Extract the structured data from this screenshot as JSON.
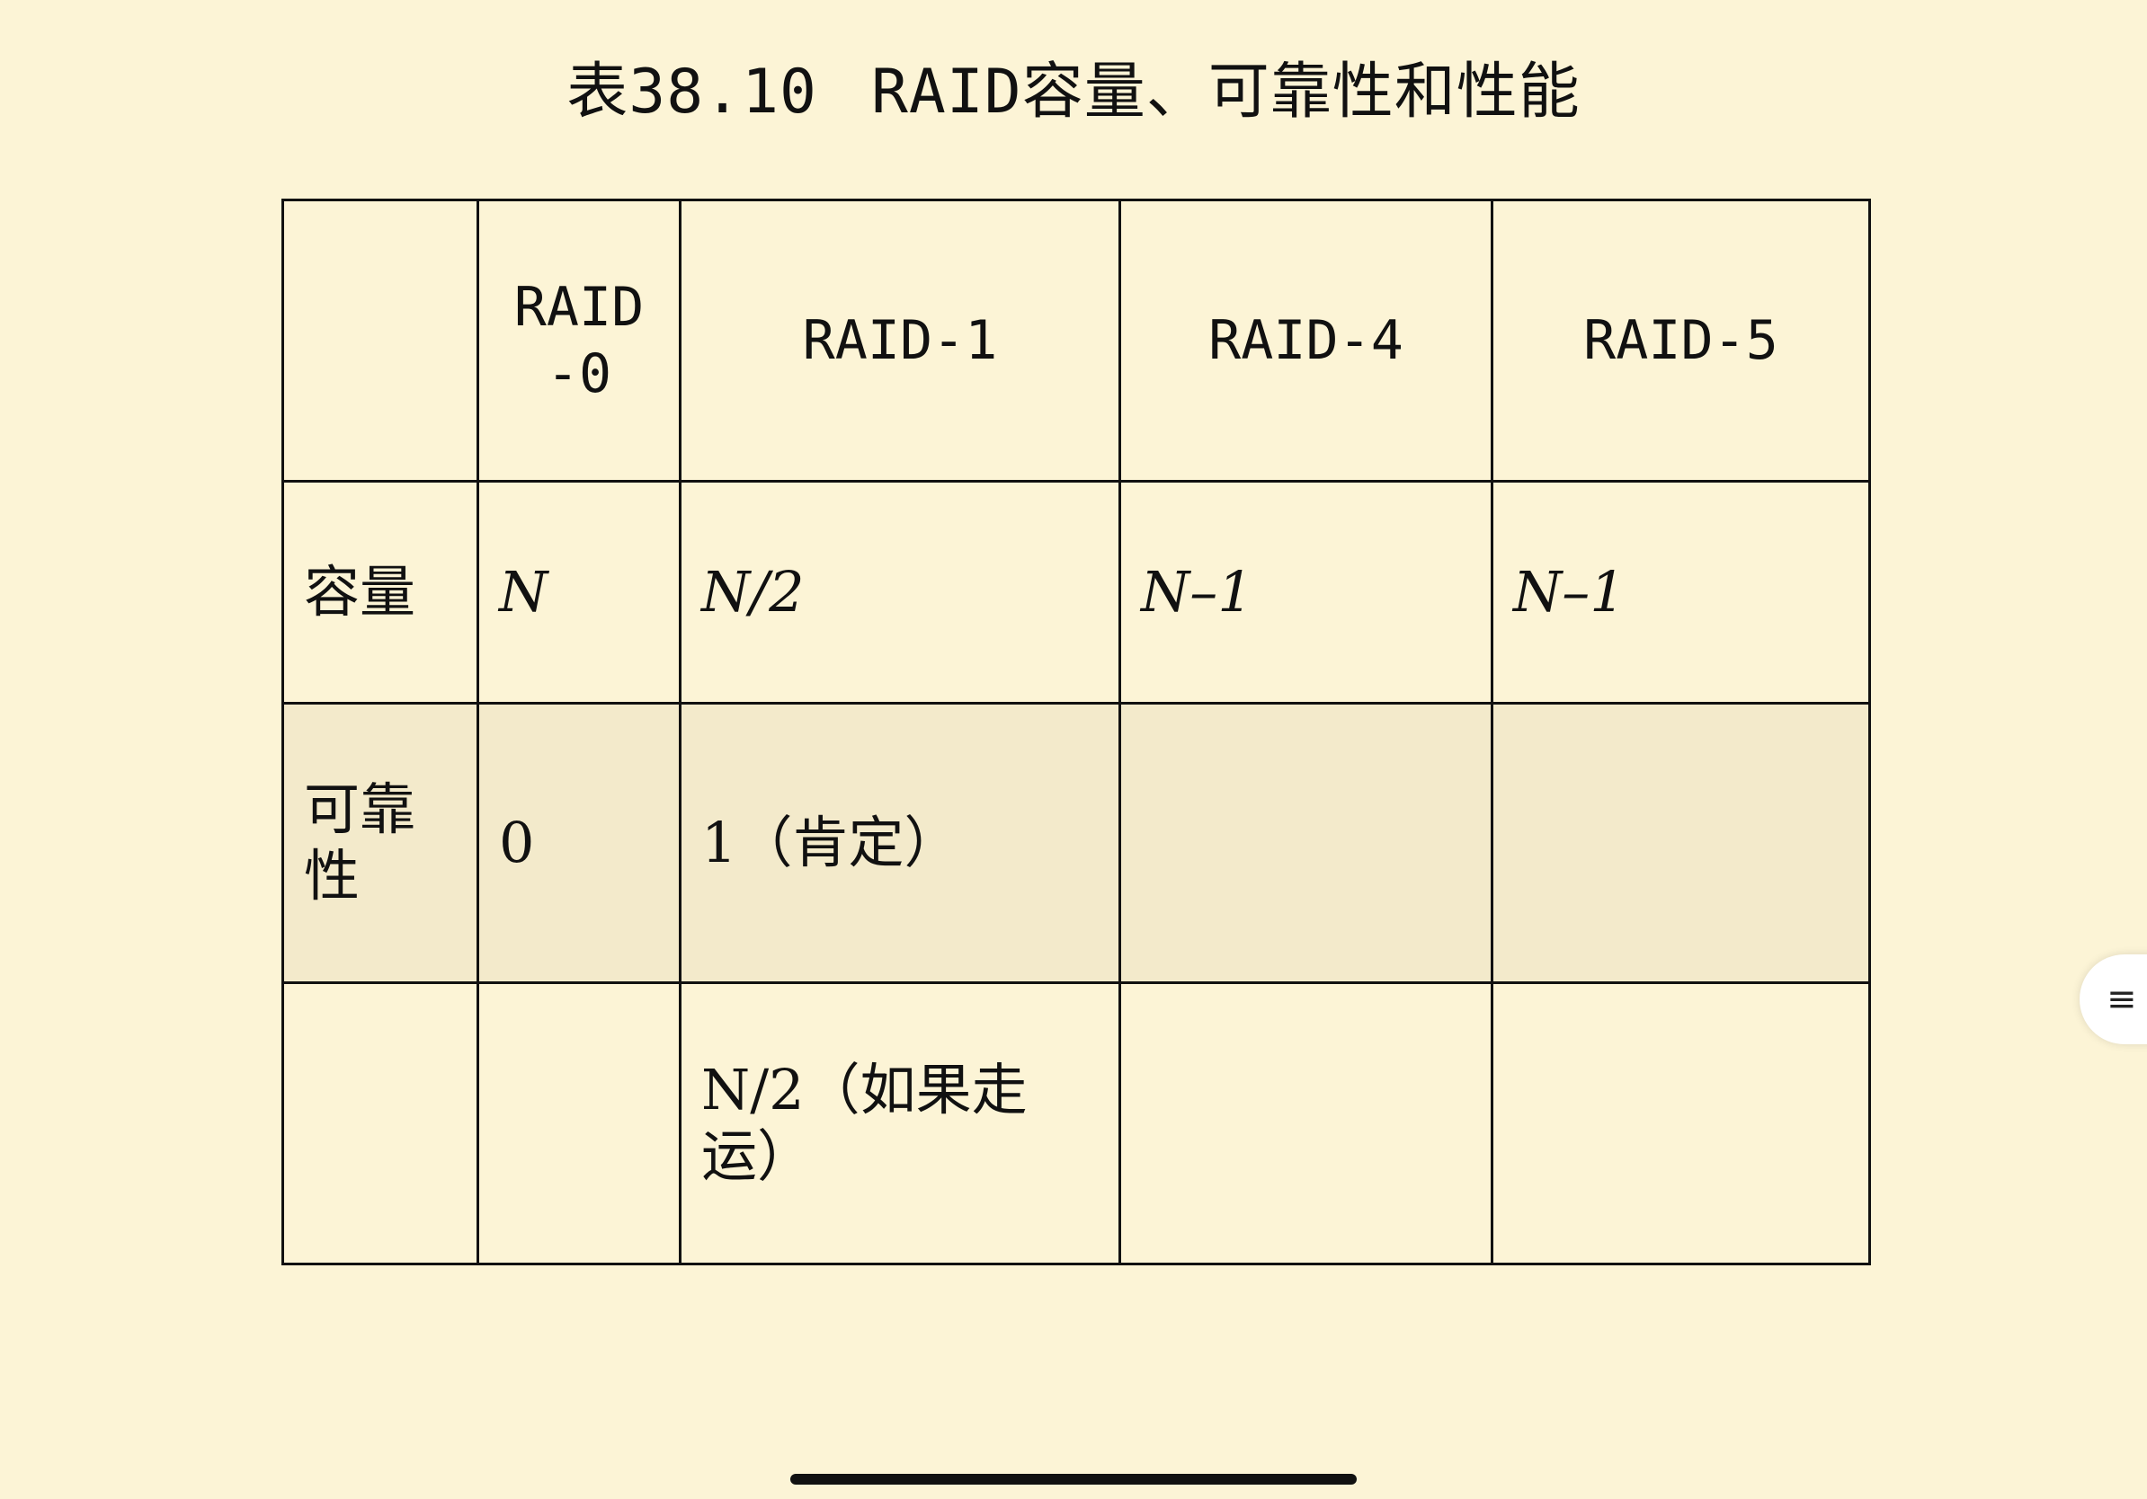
{
  "title": {
    "number": "表38.10",
    "text": "RAID容量、可靠性和性能"
  },
  "table": {
    "headers": [
      "",
      "RAID-0",
      "RAID-1",
      "RAID-4",
      "RAID-5"
    ],
    "rows": [
      [
        "容量",
        "N",
        "N/2",
        "N–1",
        "N–1"
      ],
      [
        "可靠性",
        "0",
        "1（肯定）",
        "",
        ""
      ],
      [
        "",
        "",
        "N/2（如果走运）",
        "",
        ""
      ]
    ]
  },
  "side_menu": {
    "icon": "menu-icon",
    "glyph": "≡"
  },
  "home_indicator": {
    "icon": "home-indicator-bar"
  }
}
